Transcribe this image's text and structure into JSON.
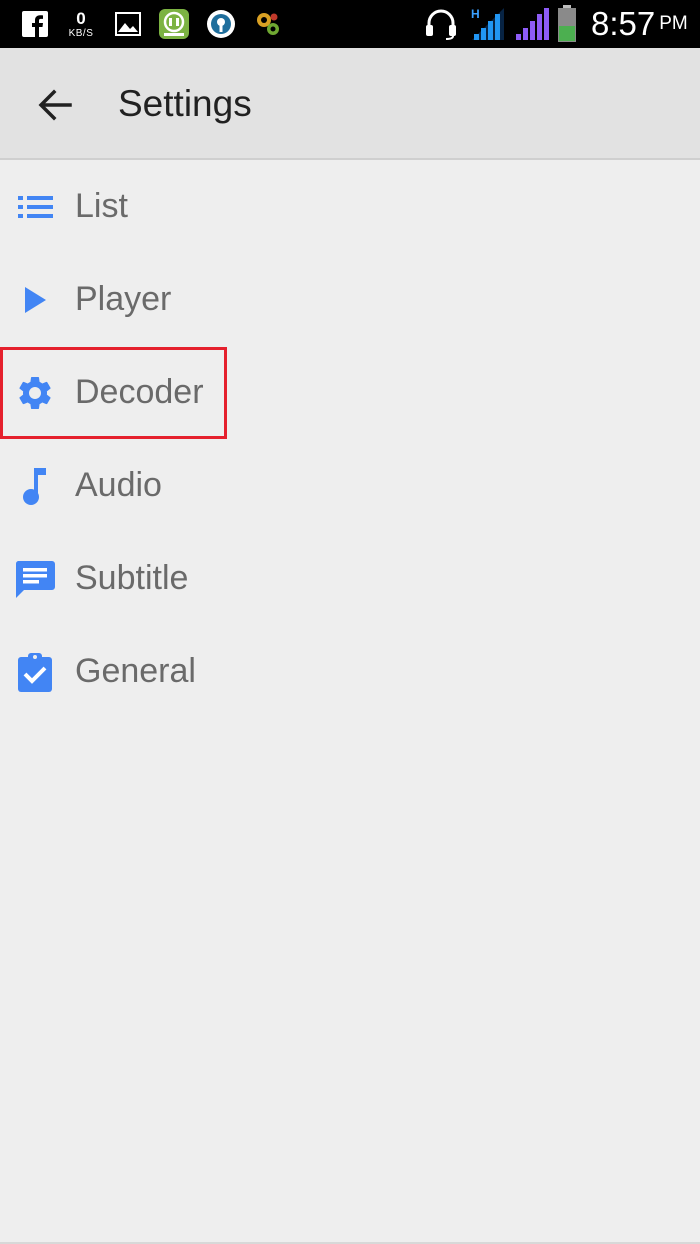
{
  "status_bar": {
    "network_speed_value": "0",
    "network_speed_unit": "KB/S",
    "notification_icons": [
      "facebook-icon",
      "image-icon",
      "philips-app-icon",
      "vpn-icon",
      "gear-app-icon"
    ],
    "right_icons": [
      "headset-icon",
      "signal-h-icon",
      "signal-icon",
      "battery-icon"
    ],
    "signal_type": "H",
    "time": "8:57",
    "ampm": "PM"
  },
  "app_bar": {
    "back_icon": "arrow-back-icon",
    "title": "Settings"
  },
  "menu": {
    "accent_color": "#4285f4",
    "items": [
      {
        "label": "List",
        "icon": "list-icon"
      },
      {
        "label": "Player",
        "icon": "play-icon"
      },
      {
        "label": "Decoder",
        "icon": "gear-icon",
        "highlighted": true
      },
      {
        "label": "Audio",
        "icon": "music-note-icon"
      },
      {
        "label": "Subtitle",
        "icon": "subtitle-message-icon"
      },
      {
        "label": "General",
        "icon": "clipboard-check-icon"
      }
    ]
  },
  "highlight_color": "#e5202d"
}
